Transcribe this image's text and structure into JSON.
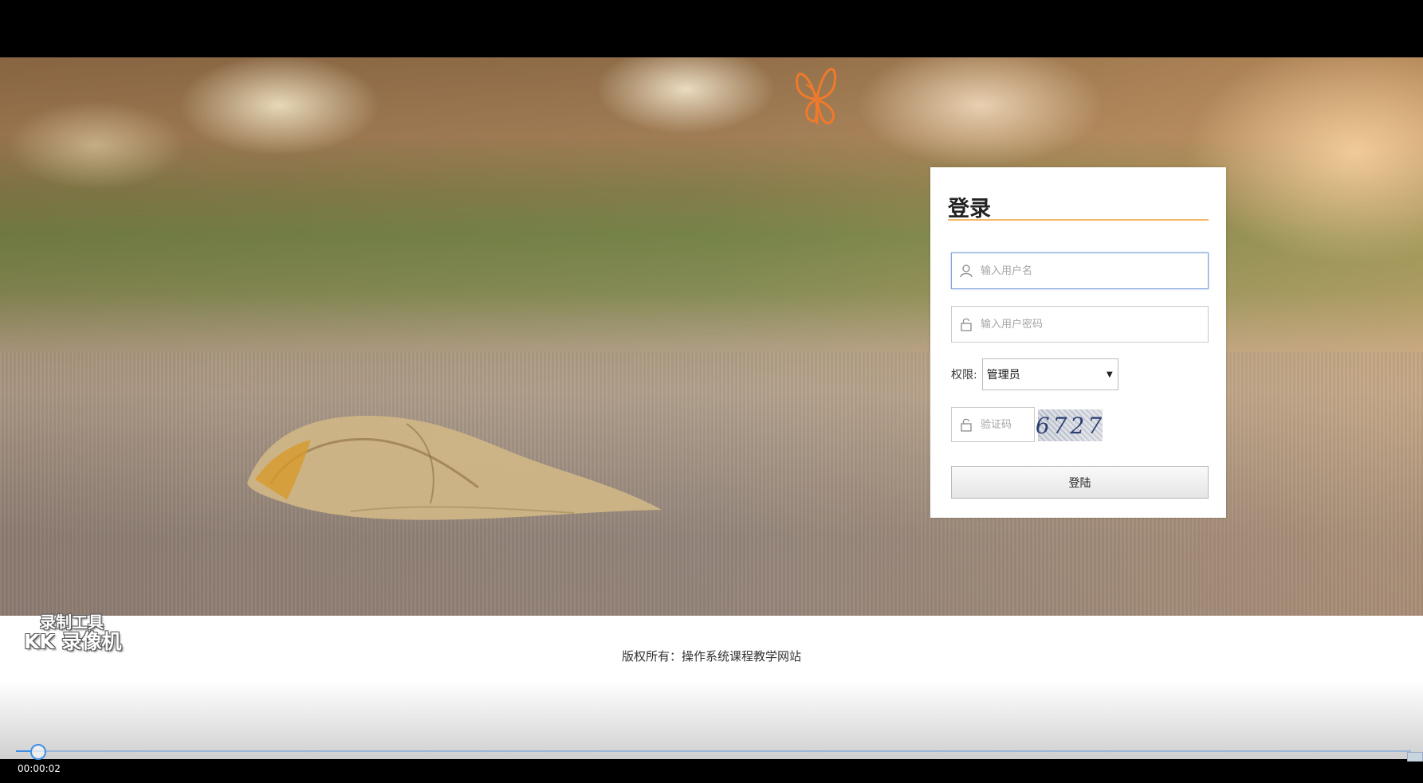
{
  "login": {
    "title": "登录",
    "username_placeholder": "输入用户名",
    "password_placeholder": "输入用户密码",
    "role_label": "权限:",
    "role_selected": "管理员",
    "captcha_placeholder": "验证码",
    "captcha_text": "6727",
    "submit_label": "登陆"
  },
  "footer": {
    "copyright": "版权所有：操作系统课程教学网站"
  },
  "watermark": {
    "line1": "录制工具",
    "line2": "KK 录像机"
  },
  "player": {
    "timecode": "00:00:02"
  },
  "colors": {
    "title_underline": "#f2b56a",
    "focus_border": "#7aa3d6",
    "progress_accent": "#3f8ee6"
  },
  "icons": {
    "username": "user-icon",
    "password": "lock-icon",
    "captcha": "lock-icon",
    "select": "caret-down-icon"
  }
}
